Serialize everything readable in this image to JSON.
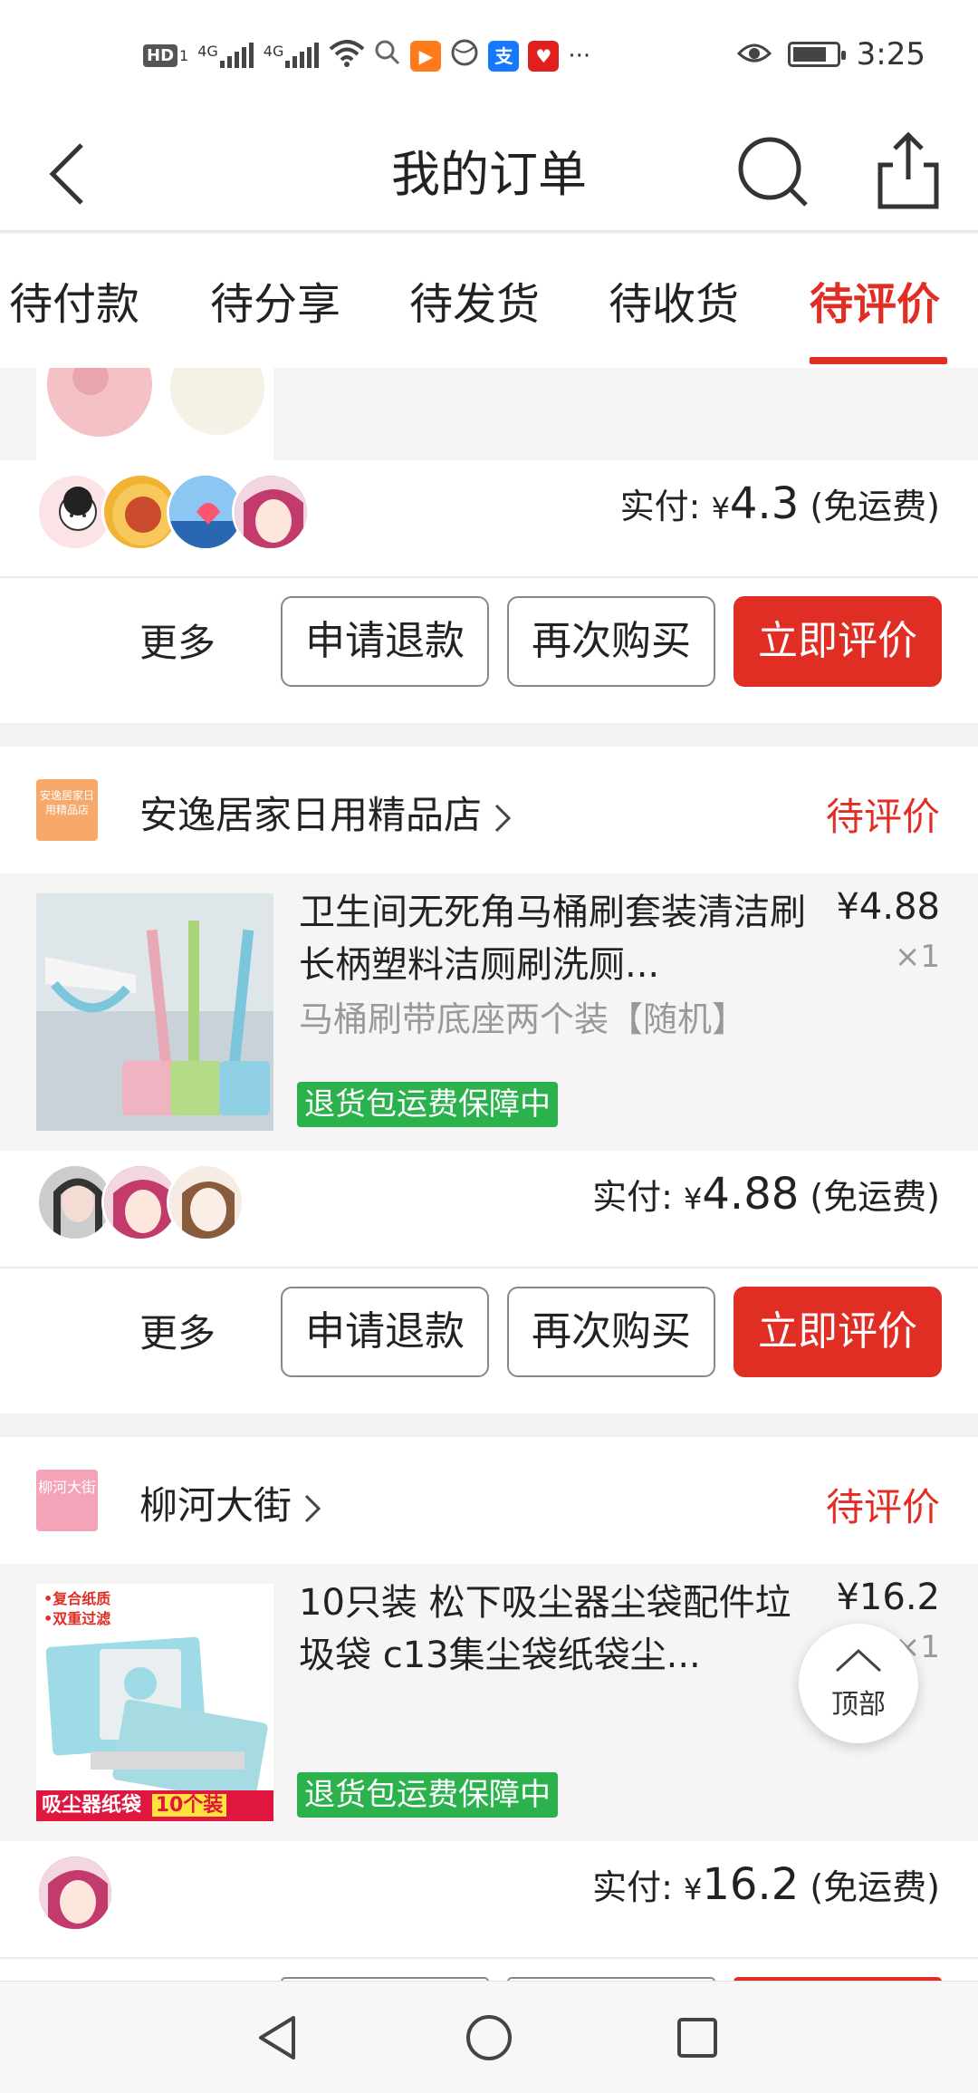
{
  "status_bar": {
    "left_icons": [
      "hd-icon",
      "signal-4g-icon",
      "signal-4g-icon",
      "wifi-icon",
      "search-icon",
      "video-app-icon",
      "browser-icon",
      "alipay-icon",
      "taobao-icon",
      "more-icon"
    ],
    "network_1": "4G",
    "network_2": "4G",
    "more": "···",
    "time": "3:25"
  },
  "header": {
    "title": "我的订单"
  },
  "tabs": {
    "items": [
      {
        "label": "待付款",
        "active": false
      },
      {
        "label": "待分享",
        "active": false
      },
      {
        "label": "待发货",
        "active": false
      },
      {
        "label": "待收货",
        "active": false
      },
      {
        "label": "待评价",
        "active": true
      }
    ]
  },
  "orders": [
    {
      "paid_label": "实付: ",
      "paid_currency": "¥",
      "paid_amount": "4.3",
      "shipping": " (免运费)",
      "actions": {
        "more": "更多",
        "refund": "申请退款",
        "rebuy": "再次购买",
        "review": "立即评价"
      }
    },
    {
      "shop_logo_text": "安逸居家日用精品店",
      "shop_name": "安逸居家日用精品店",
      "status": "待评价",
      "product_title": "卫生间无死角马桶刷套装清洁刷长柄塑料洁厕刷洗厕...",
      "product_spec": "马桶刷带底座两个装【随机】",
      "price": "¥4.88",
      "qty": "×1",
      "guarantee": "退货包运费保障中",
      "paid_label": "实付: ",
      "paid_currency": "¥",
      "paid_amount": "4.88",
      "shipping": " (免运费)",
      "actions": {
        "more": "更多",
        "refund": "申请退款",
        "rebuy": "再次购买",
        "review": "立即评价"
      }
    },
    {
      "shop_logo_text": "柳河大街",
      "shop_name": "柳河大街",
      "status": "待评价",
      "product_title": "10只装 松下吸尘器尘袋配件垃圾袋 c13集尘袋纸袋尘...",
      "thumb_text_1": "•复合纸质",
      "thumb_text_2": "•双重过滤",
      "thumb_banner": "吸尘器纸袋",
      "thumb_banner_2": "10个装",
      "price": "¥16.2",
      "qty": "×1",
      "guarantee": "退货包运费保障中",
      "paid_label": "实付: ",
      "paid_currency": "¥",
      "paid_amount": "16.2",
      "shipping": " (免运费)"
    }
  ],
  "top_button": {
    "label": "顶部"
  },
  "colors": {
    "accent": "#e02e24",
    "guarantee": "#2bb24c"
  },
  "nav_bar": {
    "icons": [
      "back-triangle-icon",
      "home-circle-icon",
      "recents-square-icon"
    ]
  }
}
